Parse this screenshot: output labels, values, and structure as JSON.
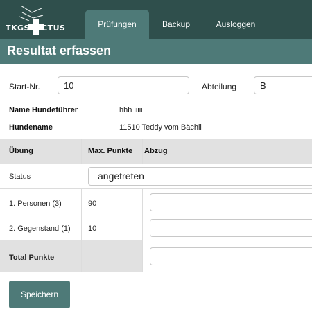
{
  "logo": {
    "left_text": "TKGS",
    "right_text": "CTUS"
  },
  "nav": {
    "tabs": [
      {
        "label": "Prüfungen",
        "active": true
      },
      {
        "label": "Backup",
        "active": false
      },
      {
        "label": "Ausloggen",
        "active": false
      }
    ]
  },
  "page": {
    "title": "Resultat erfassen"
  },
  "form": {
    "start_nr_label": "Start-Nr.",
    "start_nr_value": "10",
    "abteilung_label": "Abteilung",
    "abteilung_value": "B"
  },
  "info": {
    "handler_label": "Name Hundeführer",
    "handler_value": "hhh iiiii",
    "dog_label": "Hundename",
    "dog_value": "11510 Teddy vom Bächli"
  },
  "table": {
    "headers": [
      "Übung",
      "Max. Punkte",
      "Abzug"
    ],
    "status_label": "Status",
    "status_value": "angetreten",
    "rows": [
      {
        "exercise": "1. Personen (3)",
        "max": "90",
        "abzug": ""
      },
      {
        "exercise": "2. Gegenstand (1)",
        "max": "10",
        "abzug": ""
      }
    ],
    "total_label": "Total Punkte",
    "total_value": ""
  },
  "actions": {
    "save_label": "Speichern"
  },
  "colors": {
    "nav_bg": "#2f4f4c",
    "accent": "#4e7a78",
    "header_bg": "#e1e1e1"
  }
}
